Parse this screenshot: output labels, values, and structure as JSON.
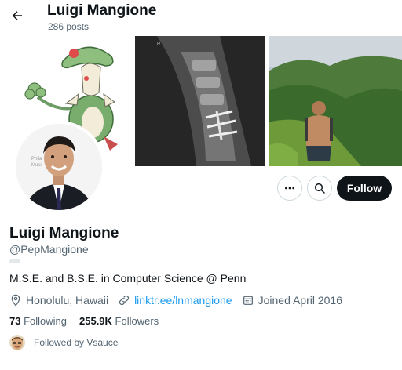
{
  "header": {
    "title": "Luigi Mangione",
    "post_count": "286 posts"
  },
  "banner": {
    "images": [
      "pokemon-artwork",
      "spine-xray",
      "hiking-photo"
    ]
  },
  "actions": {
    "follow_label": "Follow",
    "more_icon": "more-icon",
    "search_icon": "search-icon"
  },
  "profile": {
    "name": "Luigi Mangione",
    "handle": "@PepMangione",
    "bio": "M.S.E. and B.S.E. in Computer Science @ Penn",
    "location": "Honolulu, Hawaii",
    "link": "linktr.ee/lnmangione",
    "joined": "Joined April 2016"
  },
  "stats": {
    "following_count": "73",
    "following_label": " Following",
    "followers_count": "255.9K",
    "followers_label": " Followers"
  },
  "followed_by": "Followed by Vsauce",
  "colors": {
    "accent": "#1d9bf0",
    "text": "#0f1419",
    "secondary": "#536471",
    "button": "#0f1419"
  }
}
